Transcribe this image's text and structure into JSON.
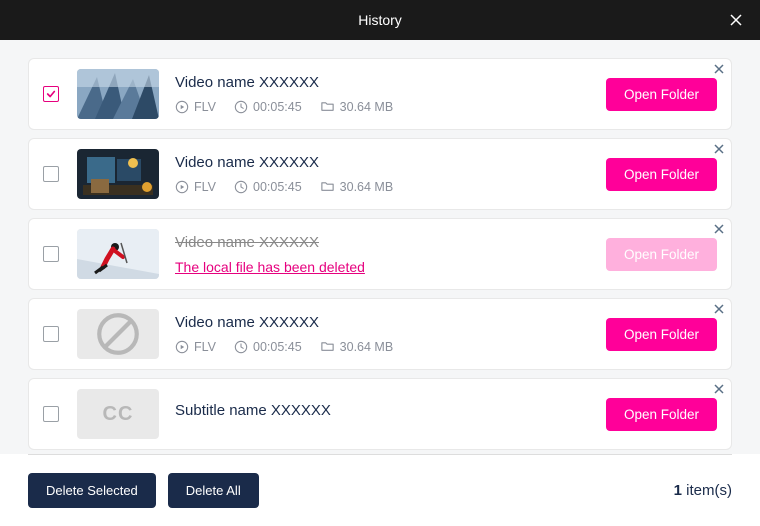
{
  "header": {
    "title": "History"
  },
  "items": [
    {
      "checked": true,
      "thumb": "buildings",
      "title": "Video name XXXXXX",
      "deleted": false,
      "hasMeta": true,
      "format": "FLV",
      "duration": "00:05:45",
      "size": "30.64 MB",
      "open_label": "Open Folder",
      "open_disabled": false
    },
    {
      "checked": false,
      "thumb": "room",
      "title": "Video name XXXXXX",
      "deleted": false,
      "hasMeta": true,
      "format": "FLV",
      "duration": "00:05:45",
      "size": "30.64 MB",
      "open_label": "Open Folder",
      "open_disabled": false
    },
    {
      "checked": false,
      "thumb": "skier",
      "title": "Video name XXXXXX",
      "deleted": true,
      "deleted_msg": "The local file has been deleted",
      "hasMeta": false,
      "open_label": "Open Folder",
      "open_disabled": true
    },
    {
      "checked": false,
      "thumb": "none",
      "title": "Video name XXXXXX",
      "deleted": false,
      "hasMeta": true,
      "format": "FLV",
      "duration": "00:05:45",
      "size": "30.64 MB",
      "open_label": "Open Folder",
      "open_disabled": false
    },
    {
      "checked": false,
      "thumb": "cc",
      "title": "Subtitle name XXXXXX",
      "deleted": false,
      "hasMeta": false,
      "open_label": "Open Folder",
      "open_disabled": false
    }
  ],
  "footer": {
    "delete_selected": "Delete Selected",
    "delete_all": "Delete All",
    "count": "1",
    "count_suffix": " item(s)"
  },
  "icons": {
    "play": "play-circle-icon",
    "clock": "clock-icon",
    "folder": "folder-icon",
    "close": "close-icon",
    "none": "no-entry-icon",
    "cc": "CC"
  }
}
